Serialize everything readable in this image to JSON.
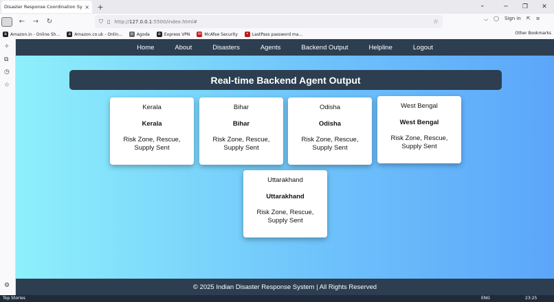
{
  "browser": {
    "tab_title": "Disaster Response Coordination Sy",
    "tab_close": "×",
    "new_tab": "+",
    "url_prefix": "http://",
    "url_host": "127.0.0.1",
    "url_rest": ":5500/index.html#",
    "sign_in": "Sign in",
    "bookmarks": [
      {
        "label": "Amazon.in - Online Sh...",
        "icon": "a",
        "color": "#222222"
      },
      {
        "label": "Amazon.co.uk - Onlin...",
        "icon": "a",
        "color": "#222222"
      },
      {
        "label": "Agoda",
        "icon": "o",
        "color": "#666666"
      },
      {
        "label": "Express VPN",
        "icon": "e",
        "color": "#222222"
      },
      {
        "label": "McAfee Security",
        "icon": "m",
        "color": "#c01818"
      },
      {
        "label": "LastPass password ma...",
        "icon": "•",
        "color": "#c01818"
      }
    ],
    "other_bookmarks": "Other Bookmarks"
  },
  "site": {
    "nav": [
      "Home",
      "About",
      "Disasters",
      "Agents",
      "Backend Output",
      "Helpline",
      "Logout"
    ],
    "heading": "Real-time Backend Agent Output",
    "cards": [
      {
        "title": "Kerala",
        "name": "Kerala",
        "status": "Risk Zone, Rescue, Supply Sent"
      },
      {
        "title": "Bihar",
        "name": "Bihar",
        "status": "Risk Zone, Rescue, Supply Sent"
      },
      {
        "title": "Odisha",
        "name": "Odisha",
        "status": "Risk Zone, Rescue, Supply Sent"
      },
      {
        "title": "West Bengal",
        "name": "West Bengal",
        "status": "Risk Zone, Rescue, Supply Sent"
      },
      {
        "title": "Uttarakhand",
        "name": "Uttarakhand",
        "status": "Risk Zone, Rescue, Supply Sent"
      }
    ],
    "footer": "© 2025 Indian Disaster Response System | All Rights Reserved"
  },
  "taskbar": {
    "news": "Top Stories",
    "lang": "ENG",
    "time": "23:25"
  }
}
